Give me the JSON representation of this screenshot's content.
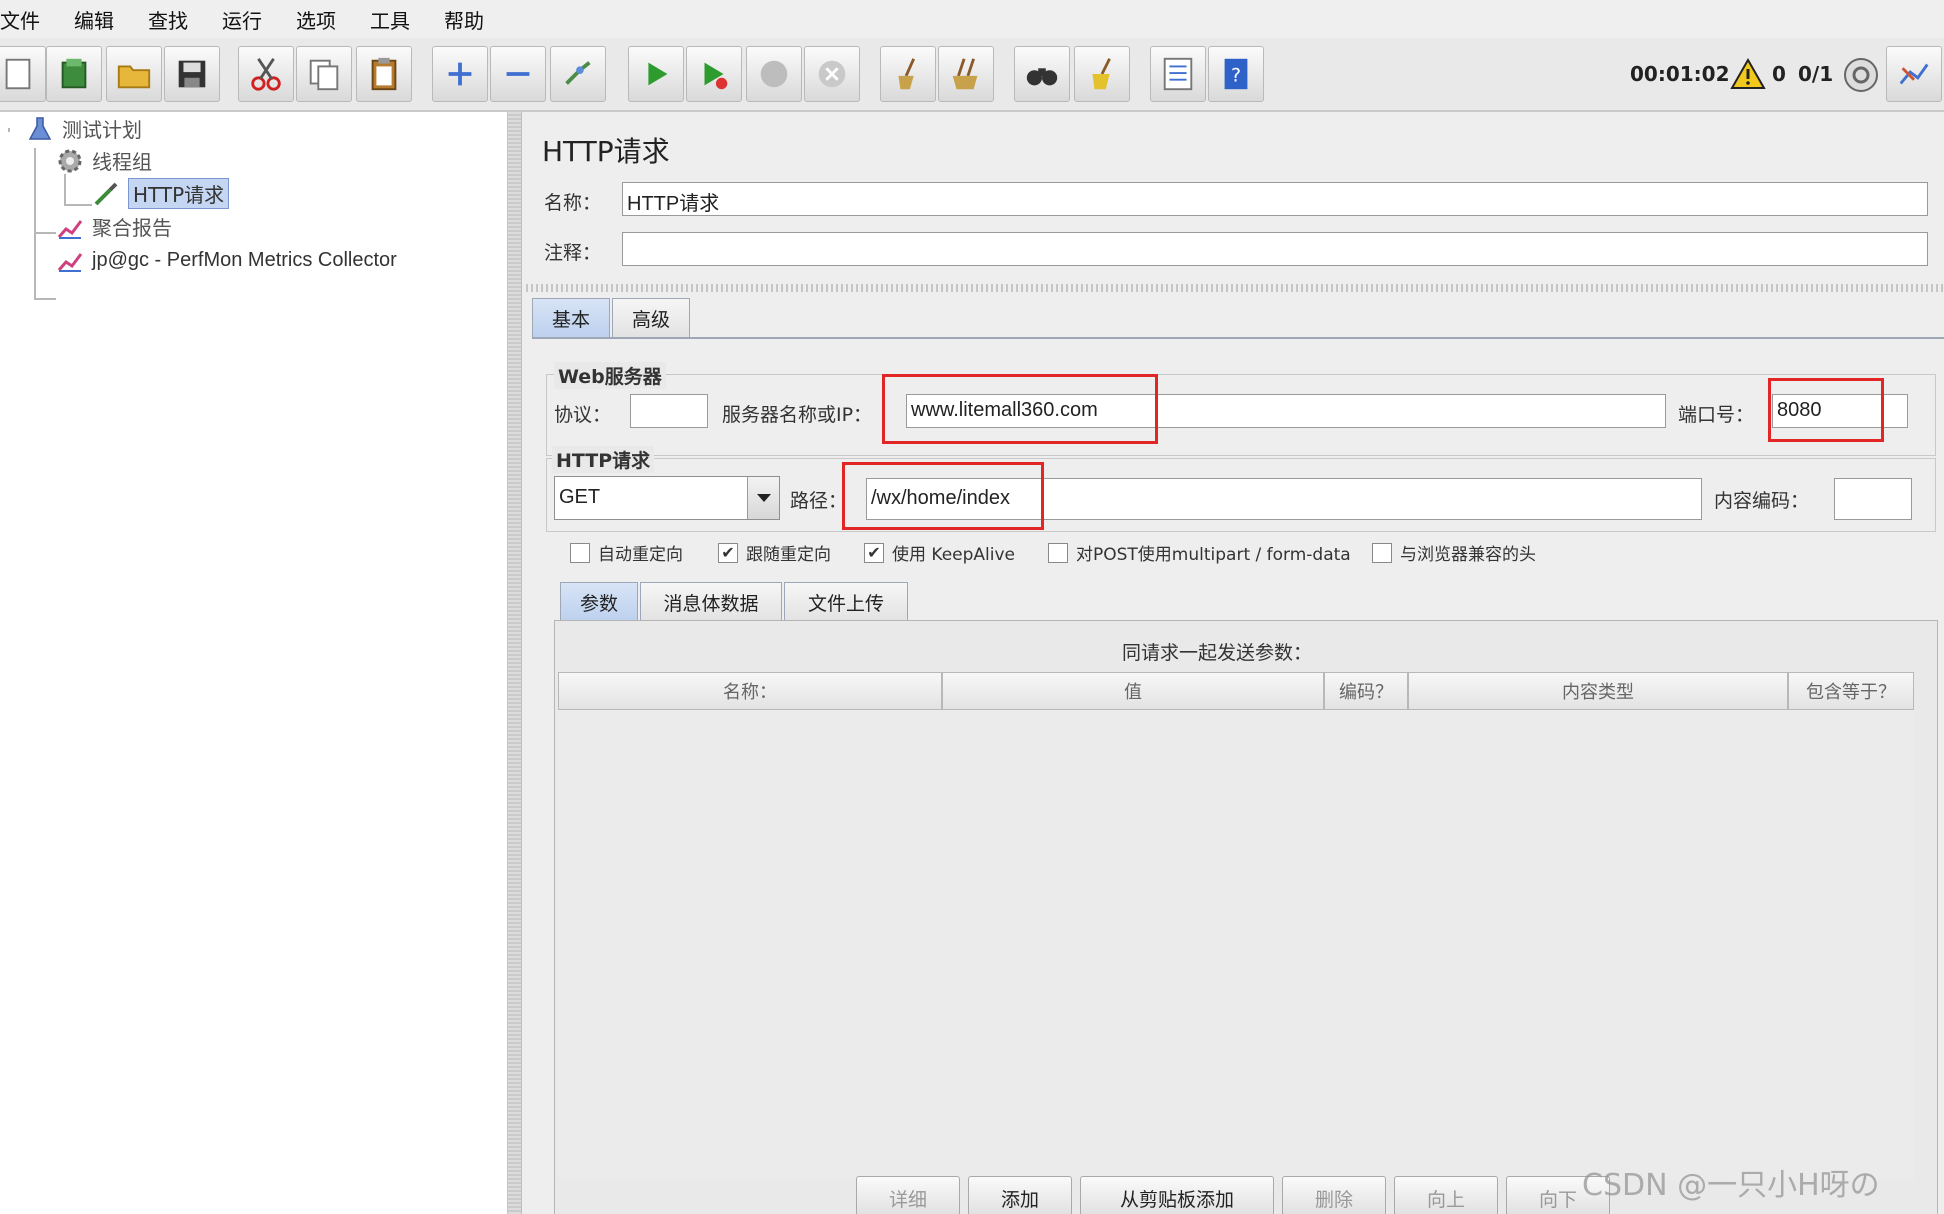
{
  "menu": [
    "文件",
    "编辑",
    "查找",
    "运行",
    "选项",
    "工具",
    "帮助"
  ],
  "toolbar": {
    "timer": "00:01:02",
    "warning_count": "0",
    "threads": "0/1"
  },
  "tree": {
    "items": [
      {
        "label": "测试计划"
      },
      {
        "label": "线程组"
      },
      {
        "label": "HTTP请求"
      },
      {
        "label": "聚合报告"
      },
      {
        "label": "jp@gc - PerfMon Metrics Collector"
      }
    ]
  },
  "panel": {
    "title": "HTTP请求",
    "name_label": "名称：",
    "name_value": "HTTP请求",
    "comment_label": "注释：",
    "comment_value": "",
    "tabs": [
      "基本",
      "高级"
    ],
    "web_server": {
      "title": "Web服务器",
      "protocol_label": "协议：",
      "protocol_value": "",
      "server_label": "服务器名称或IP：",
      "server_value": "www.litemall360.com",
      "port_label": "端口号：",
      "port_value": "8080"
    },
    "http_request": {
      "title": "HTTP请求",
      "method": "GET",
      "path_label": "路径：",
      "path_value": "/wx/home/index",
      "encoding_label": "内容编码：",
      "encoding_value": ""
    },
    "checkboxes": [
      {
        "label": "自动重定向",
        "checked": false
      },
      {
        "label": "跟随重定向",
        "checked": true
      },
      {
        "label": "使用 KeepAlive",
        "checked": true
      },
      {
        "label": "对POST使用multipart / form-data",
        "checked": false
      },
      {
        "label": "与浏览器兼容的头",
        "checked": false
      }
    ],
    "sub_tabs": [
      "参数",
      "消息体数据",
      "文件上传"
    ],
    "params": {
      "title": "同请求一起发送参数：",
      "columns": [
        "名称：",
        "值",
        "编码？",
        "内容类型",
        "包含等于？"
      ]
    },
    "buttons": [
      "详细",
      "添加",
      "从剪贴板添加",
      "删除",
      "向上",
      "向下"
    ]
  },
  "watermark": "CSDN @一只小H呀の"
}
